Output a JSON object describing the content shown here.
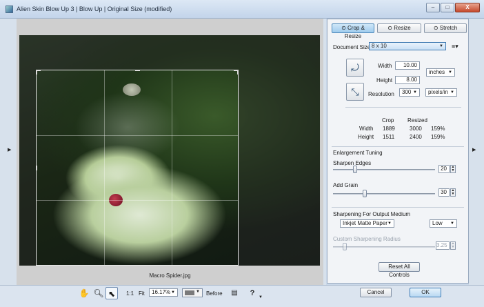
{
  "window": {
    "title": "Alien Skin Blow Up 3 | Blow Up | Original Size (modified)",
    "minimize": "–",
    "maximize": "□",
    "close": "X"
  },
  "canvas": {
    "filename": "Macro Spider.jpg"
  },
  "tabs": [
    {
      "label": "Crop & Resize",
      "active": true
    },
    {
      "label": "Resize",
      "active": false
    },
    {
      "label": "Stretch",
      "active": false
    }
  ],
  "document": {
    "label": "Document Size",
    "value": "8 x 10",
    "width_label": "Width",
    "width_value": "10.00",
    "height_label": "Height",
    "height_value": "8.00",
    "unit": "inches",
    "resolution_label": "Resolution",
    "resolution_value": "300",
    "resolution_unit": "pixels/in"
  },
  "size_table": {
    "headers": [
      "",
      "Crop",
      "Resized",
      ""
    ],
    "rows": [
      [
        "Width",
        "1889",
        "3000",
        "159%"
      ],
      [
        "Height",
        "1511",
        "2400",
        "159%"
      ]
    ]
  },
  "enlargement": {
    "title": "Enlargement Tuning",
    "sharpen_label": "Sharpen Edges",
    "sharpen_value": "20",
    "grain_label": "Add Grain",
    "grain_value": "30"
  },
  "output": {
    "title": "Sharpening For Output Medium",
    "medium": "Inkjet Matte Paper",
    "level": "Low",
    "radius_label": "Custom Sharpening Radius",
    "radius_value": "3.25"
  },
  "buttons": {
    "reset": "Reset All Controls",
    "cancel": "Cancel",
    "ok": "OK"
  },
  "toolbar": {
    "zoom_1to1": "1:1",
    "fit": "Fit",
    "zoom": "16.17%",
    "before": "Before"
  },
  "icons": {
    "hand": "hand-icon",
    "zoom": "magnifier-icon",
    "pointer": "pointer-icon",
    "help": "help-icon"
  }
}
